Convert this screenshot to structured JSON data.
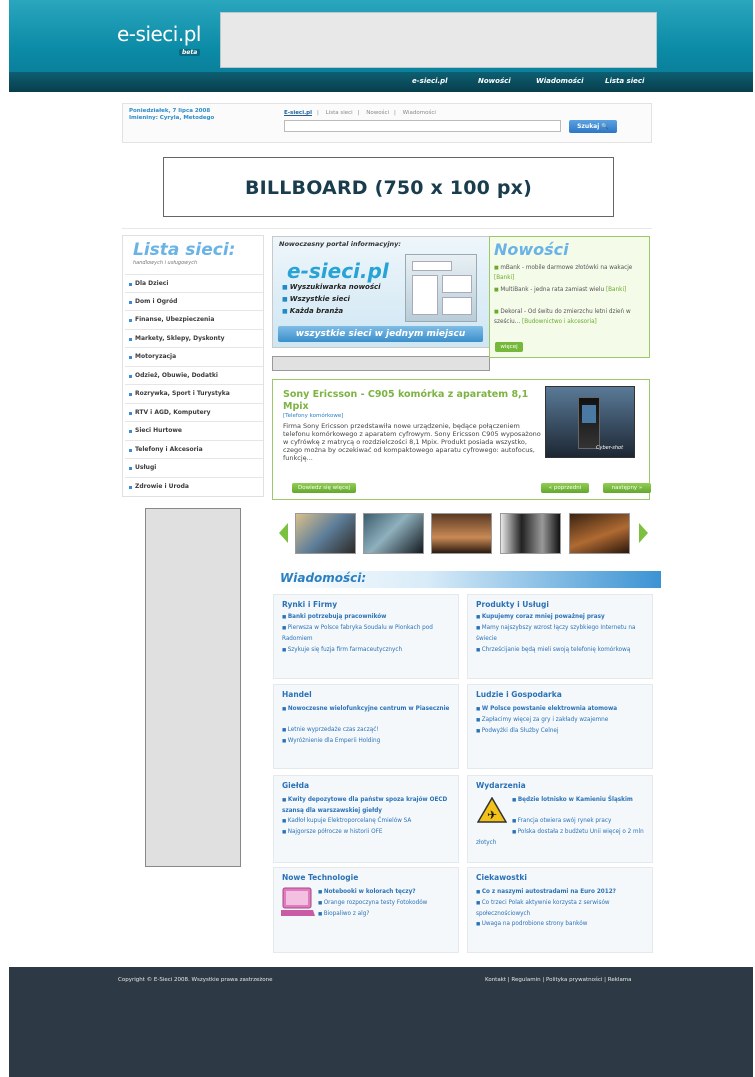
{
  "header": {
    "logo": "e-sieci.pl",
    "logo_badge": "beta",
    "nav": [
      "e-sieci.pl",
      "Nowości",
      "Wiadomości",
      "Lista sieci"
    ]
  },
  "topbar": {
    "date_line1": "Poniedziałek, 7 lipca 2008",
    "date_line2": "Imieniny: Cyryla, Metodego",
    "search_tabs": [
      "E-sieci.pl",
      "Lista sieci",
      "Nowości",
      "Wiadomości"
    ],
    "search_value": "",
    "search_button": "Szukaj"
  },
  "billboard": "BILLBOARD (750 x 100 px)",
  "sidebar": {
    "title": "Lista sieci:",
    "subtitle": "handlowych i usługowych",
    "items": [
      "Dla Dzieci",
      "Dom i Ogród",
      "Finanse, Ubezpieczenia",
      "Markety, Sklepy, Dyskonty",
      "Motoryzacja",
      "Odzież, Obuwie, Dodatki",
      "Rozrywka, Sport i Turystyka",
      "RTV i AGD, Komputery",
      "Sieci Hurtowe",
      "Telefony i Akcesoria",
      "Usługi",
      "Zdrowie i Uroda"
    ]
  },
  "promo": {
    "title": "Nowoczesny portal informacyjny:",
    "logo": "e-sieci.pl",
    "bullets": [
      "Wyszukiwarka nowości",
      "Wszystkie sieci",
      "Każda branża"
    ],
    "band": "wszystkie sieci w jednym miejscu"
  },
  "nowosci": {
    "title": "Nowości",
    "items": [
      {
        "text": "mBank - mobile darmowe złotówki na wakacje",
        "tag": "[Banki]"
      },
      {
        "text": "MultiBank - jedna rata zamiast wielu",
        "tag": "[Banki]"
      },
      {
        "text": "Dekoral - Od świtu do zmierzchu letni dzień w sześciu...",
        "tag": "[Budownictwo i akcesoria]"
      }
    ],
    "more": "więcej"
  },
  "feature": {
    "title": "Sony Ericsson - C905 komórka z aparatem 8,1 Mpix",
    "category": "[Telefony komórkowe]",
    "body": "Firma Sony Ericsson przedstawiła nowe urządzenie, będące połączeniem telefonu komórkowego z aparatem cyfrowym. Sony Ericsson C905 wyposażono w cyfrówkę z matrycą o rozdzielczości 8,1 Mpix. Produkt posiada wszystko, czego można by oczekiwać od kompaktowego aparatu cyfrowego: autofocus, funkcję...",
    "image_text": "Cyber-shot",
    "more": "Dowiedz się więcej",
    "prev": "« poprzedni",
    "next": "następny »"
  },
  "wiadomosci": {
    "title": "Wiadomości:",
    "boxes": [
      {
        "title": "Rynki i Firmy",
        "items": [
          "Banki potrzebują pracowników",
          "Pierwsza w Polsce fabryka Soudalu w Pionkach pod Radomiem",
          "Szykuje się fuzja firm farmaceutycznych"
        ]
      },
      {
        "title": "Produkty i Usługi",
        "items": [
          "Kupujemy coraz mniej poważnej prasy",
          "Mamy najszybszy wzrost łączy szybkiego Internetu na świecie",
          "Chrześcijanie będą mieli swoją telefonię komórkową"
        ]
      },
      {
        "title": "Handel",
        "items": [
          "Nowoczesne wielofunkcyjne centrum w Piasecznie",
          "Letnie wyprzedaże czas zacząć!",
          "Wyróżnienie dla Emperii Holding"
        ]
      },
      {
        "title": "Ludzie i Gospodarka",
        "items": [
          "W Polsce powstanie elektrownia atomowa",
          "Zapłacimy więcej za gry i zakłady wzajemne",
          "Podwyżki dla Służby Celnej"
        ]
      },
      {
        "title": "Giełda",
        "items": [
          "Kwity depozytowe dla państw spoza krajów OECD szansą dla warszawskiej giełdy",
          "Kadłoł kupuje Elektroporcelanę Ćmielów SA",
          "Najgorsze półrocze w historii OFE"
        ]
      },
      {
        "title": "Wydarzenia",
        "items": [
          "Będzie lotnisko w Kamieniu Śląskim",
          "Francja otwiera swój rynek pracy",
          "Polska dostała z budżetu Unii więcej o 2 mln złotych"
        ]
      },
      {
        "title": "Nowe Technologie",
        "items": [
          "Notebooki w kolorach tęczy?",
          "Orange rozpoczyna testy Fotokodów",
          "Biopaliwo z alg?"
        ]
      },
      {
        "title": "Ciekawostki",
        "items": [
          "Co z naszymi autostradami na Euro 2012?",
          "Co trzeci Polak aktywnie korzysta z serwisów społecznościowych",
          "Uwaga na podrobione strony banków"
        ]
      }
    ]
  },
  "footer": {
    "copyright": "Copyright © E-Sieci 2008. Wszystkie prawa zastrzeżone",
    "links": "Kontakt | Regulamin | Polityka prywatności | Reklama"
  },
  "colors": {
    "header": "#0b8aa6",
    "nav_bar": "#083e4c",
    "accent_blue": "#2a72b8",
    "accent_green": "#7cb342",
    "footer": "#2d3a45"
  }
}
